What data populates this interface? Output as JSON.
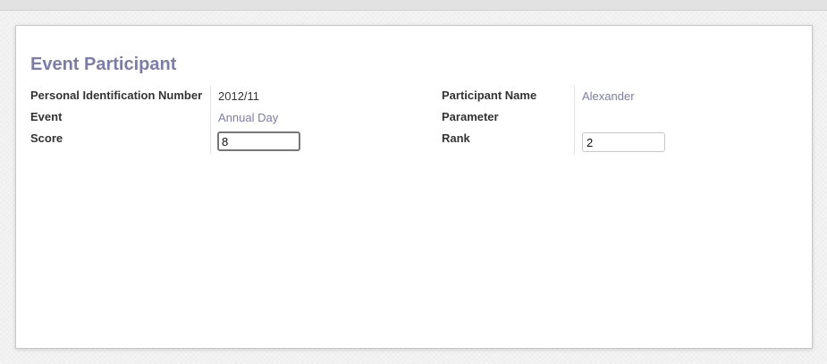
{
  "form": {
    "title": "Event Participant",
    "left": {
      "pin_label": "Personal Identification Number",
      "pin_value": "2012/11",
      "event_label": "Event",
      "event_value": "Annual Day",
      "score_label": "Score",
      "score_value": "8"
    },
    "right": {
      "participant_label": "Participant Name",
      "participant_value": "Alexander",
      "parameter_label": "Parameter",
      "parameter_value": "",
      "rank_label": "Rank",
      "rank_value": "2"
    }
  },
  "colors": {
    "accent": "#7c7bad",
    "label": "#333333",
    "border": "#c8c8c8"
  }
}
